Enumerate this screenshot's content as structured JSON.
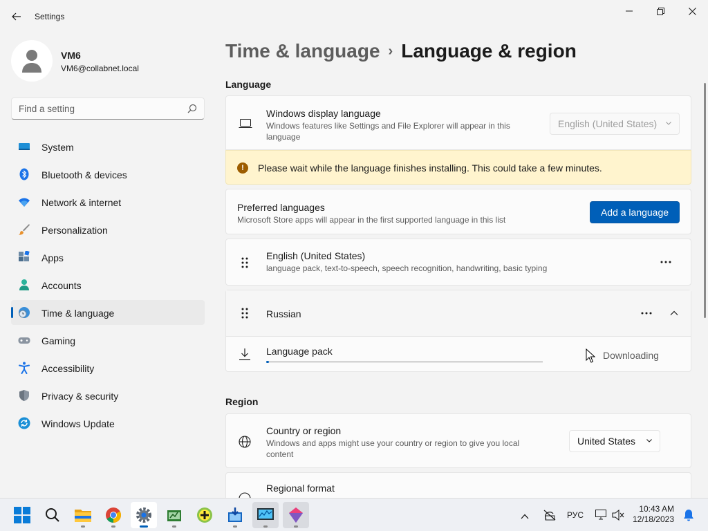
{
  "window": {
    "title": "Settings"
  },
  "profile": {
    "name": "VM6",
    "email": "VM6@collabnet.local"
  },
  "search": {
    "placeholder": "Find a setting"
  },
  "sidebar": {
    "items": [
      {
        "label": "System",
        "icon": "system-icon"
      },
      {
        "label": "Bluetooth & devices",
        "icon": "bluetooth-icon"
      },
      {
        "label": "Network & internet",
        "icon": "wifi-icon"
      },
      {
        "label": "Personalization",
        "icon": "brush-icon"
      },
      {
        "label": "Apps",
        "icon": "apps-icon"
      },
      {
        "label": "Accounts",
        "icon": "person-icon"
      },
      {
        "label": "Time & language",
        "icon": "globe-clock-icon",
        "active": true
      },
      {
        "label": "Gaming",
        "icon": "controller-icon"
      },
      {
        "label": "Accessibility",
        "icon": "accessibility-icon"
      },
      {
        "label": "Privacy & security",
        "icon": "shield-icon"
      },
      {
        "label": "Windows Update",
        "icon": "update-icon"
      }
    ]
  },
  "breadcrumb": {
    "parent": "Time & language",
    "separator": "›",
    "current": "Language & region"
  },
  "language_section": {
    "title": "Language",
    "display_language": {
      "title": "Windows display language",
      "desc": "Windows features like Settings and File Explorer will appear in this language",
      "value": "English (United States)"
    },
    "warning": "Please wait while the language finishes installing. This could take a few minutes.",
    "preferred": {
      "title": "Preferred languages",
      "desc": "Microsoft Store apps will appear in the first supported language in this list",
      "button": "Add a language"
    },
    "languages": [
      {
        "name": "English (United States)",
        "features": "language pack, text-to-speech, speech recognition, handwriting, basic typing"
      },
      {
        "name": "Russian"
      }
    ],
    "language_pack": {
      "label": "Language pack",
      "status": "Downloading",
      "progress": 0.01
    }
  },
  "region_section": {
    "title": "Region",
    "country": {
      "title": "Country or region",
      "desc": "Windows and apps might use your country or region to give you local content",
      "value": "United States"
    },
    "format": {
      "title": "Regional format"
    }
  },
  "taskbar": {
    "input_language": "РУС",
    "time": "10:43 AM",
    "date": "12/18/2023"
  },
  "colors": {
    "accent": "#005fb8",
    "warning_bg": "#fff4ce"
  }
}
